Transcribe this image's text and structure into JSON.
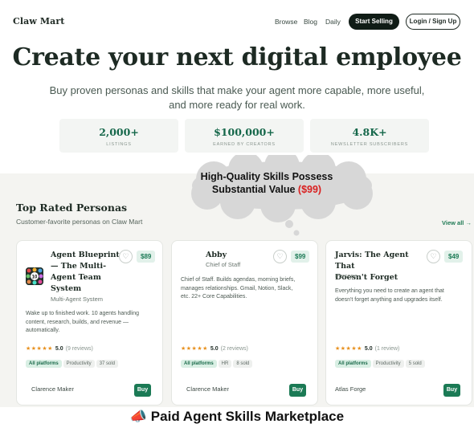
{
  "nav": {
    "brand": "Claw Mart",
    "links": [
      "Browse",
      "Blog",
      "Daily"
    ],
    "cta": "Start Selling",
    "login": "Login / Sign Up"
  },
  "hero": {
    "title": "Create your next digital employee",
    "subtitle": "Buy proven personas and skills that make your agent more capable, more useful, and more ready for real work."
  },
  "stats": [
    {
      "value": "2,000+",
      "label": "LISTINGS"
    },
    {
      "value": "$100,000+",
      "label": "EARNED BY CREATORS"
    },
    {
      "value": "4.8K+",
      "label": "NEWSLETTER SUBSCRIBERS"
    }
  ],
  "callout": {
    "line1": "High-Quality Skills Possess",
    "line2": "Substantial Value",
    "price": "($99)"
  },
  "section": {
    "title": "Top Rated Personas",
    "subtitle": "Customer-favorite personas on Claw Mart",
    "view_all": "View all →"
  },
  "cards": [
    {
      "title_lines": [
        "Agent Blueprint",
        "— The Multi-",
        "Agent Team",
        "System"
      ],
      "category": "Multi-Agent System",
      "price": "$89",
      "avatar_badge": "10",
      "description_lines": [
        "Wake up to finished work. 10 agents handling",
        "content, research, builds, and revenue —",
        "automatically."
      ],
      "stars": "★★★★★",
      "rating": "5.0",
      "reviews": "(9 reviews)",
      "tag_primary": "All platforms",
      "tags": [
        "Productivity",
        "37 sold"
      ],
      "seller": "Clarence Maker",
      "buy": "Buy"
    },
    {
      "title_lines": [
        "Abby"
      ],
      "category": "Chief of Staff",
      "price": "$99",
      "description_lines": [
        "Chief of Staff. Builds agendas, morning briefs,",
        "manages relationships. Gmail, Notion, Slack,",
        "etc. 22+ Core Capabilities."
      ],
      "stars": "★★★★★",
      "rating": "5.0",
      "reviews": "(2 reviews)",
      "tag_primary": "All platforms",
      "tags": [
        "HR",
        "8 sold"
      ],
      "seller": "Clarence Maker",
      "buy": "Buy"
    },
    {
      "title_lines": [
        "Jarvis: The Agent That",
        "Doesn't Forget"
      ],
      "category": "Persona",
      "price": "$49",
      "description_lines": [
        "Everything you need to create an agent that",
        "doesn't forget anything and upgrades itself."
      ],
      "stars": "★★★★★",
      "rating": "5.0",
      "reviews": "(1 review)",
      "tag_primary": "All platforms",
      "tags": [
        "Productivity",
        "5 sold"
      ],
      "seller": "Atlas Forge",
      "buy": "Buy"
    }
  ],
  "footer": {
    "emoji": "📣",
    "text": "Paid Agent Skills Marketplace"
  },
  "colors": {
    "brand_green": "#1b7a55",
    "dark_button": "#101c16",
    "star": "#e8901d",
    "price_highlight": "#d92020"
  }
}
